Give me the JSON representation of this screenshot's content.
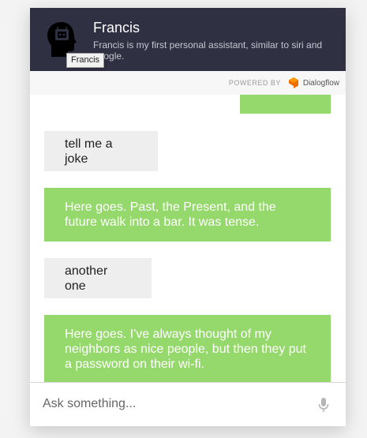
{
  "header": {
    "title": "Francis",
    "subtitle": "Francis is my first personal assistant, similar to siri and google.",
    "avatar_tooltip": "Francis",
    "background_color": "#2f3042"
  },
  "powered_by": {
    "label": "POWERED BY",
    "brand": "Dialogflow",
    "brand_icon": "dialogflow-logo",
    "brand_color": "#ef6c00"
  },
  "messages": [
    {
      "from": "bot",
      "text": ""
    },
    {
      "from": "user",
      "text": "tell me a joke"
    },
    {
      "from": "bot",
      "text": "Here goes. Past, the Present, and the future walk into a bar. It was tense."
    },
    {
      "from": "user",
      "text": "another one"
    },
    {
      "from": "bot",
      "text": "Here goes. I've always thought of my neighbors as nice people, but then they put a password on their wi-fi."
    }
  ],
  "colors": {
    "bot_bubble": "#95d86b",
    "user_bubble": "#eeeeee"
  },
  "input": {
    "placeholder": "Ask something...",
    "value": "",
    "mic_icon": "microphone-icon"
  }
}
